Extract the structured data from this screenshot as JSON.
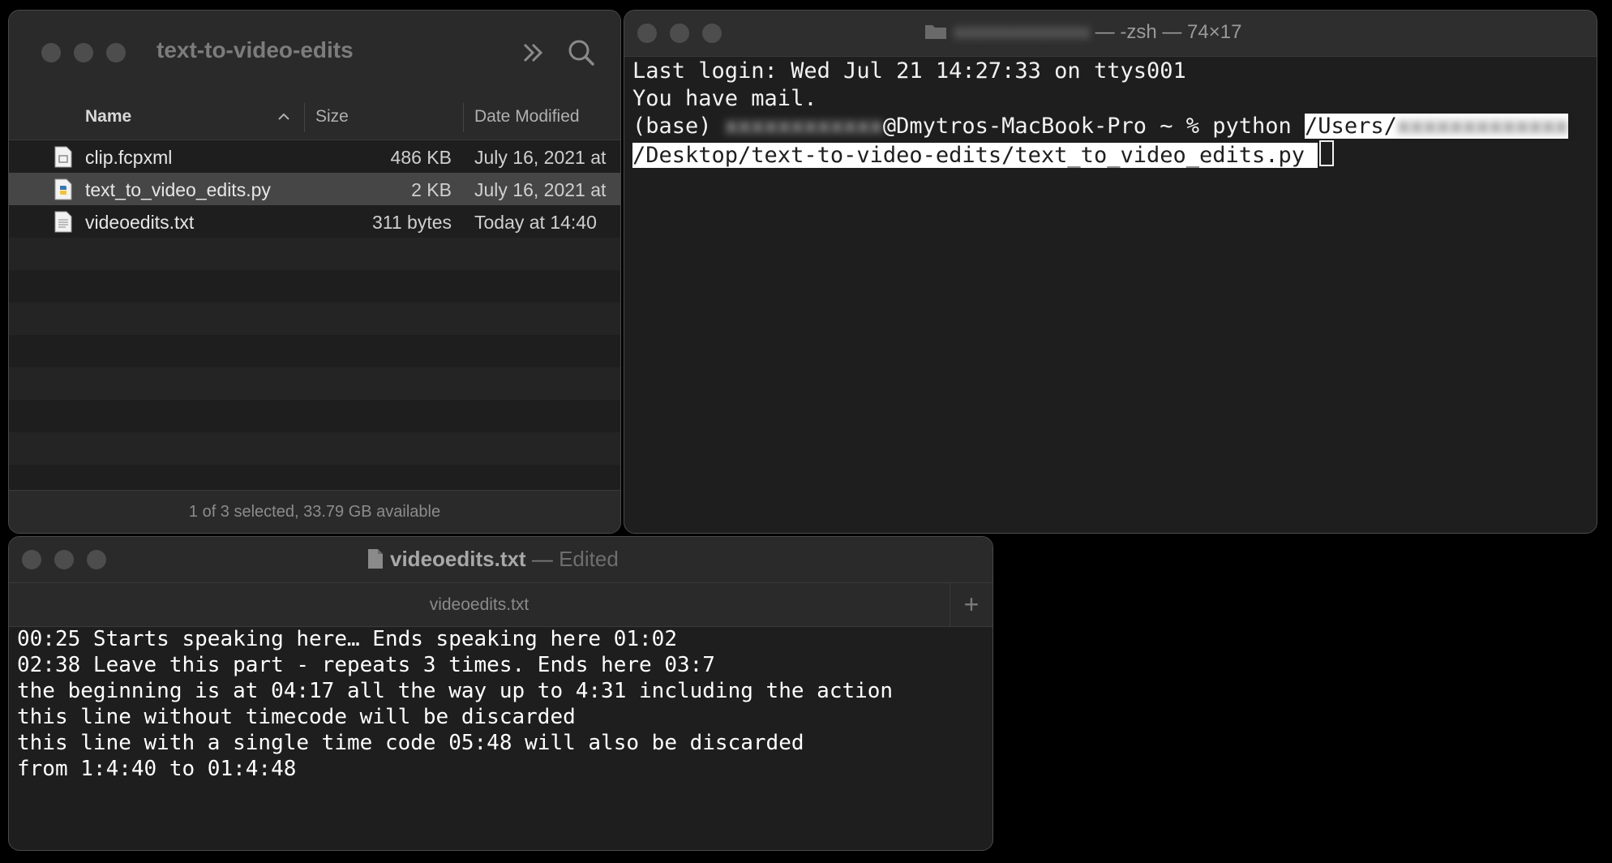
{
  "finder": {
    "title": "text-to-video-edits",
    "columns": {
      "name": "Name",
      "size": "Size",
      "date": "Date Modified"
    },
    "files": [
      {
        "name": "clip.fcpxml",
        "size": "486 KB",
        "date": "July 16, 2021 at",
        "icon": "fcpxml-file-icon",
        "selected": false
      },
      {
        "name": "text_to_video_edits.py",
        "size": "2 KB",
        "date": "July 16, 2021 at",
        "icon": "python-file-icon",
        "selected": true
      },
      {
        "name": "videoedits.txt",
        "size": "311 bytes",
        "date": "Today at 14:40",
        "icon": "text-file-icon",
        "selected": false
      }
    ],
    "status": "1 of 3 selected, 33.79 GB available"
  },
  "terminal": {
    "title_suffix": "— -zsh — 74×17",
    "lines": {
      "l1": "Last login: Wed Jul 21 14:27:33 on ttys001",
      "l2": "You have mail.",
      "l3_prefix": "(base) ",
      "l3_host": "@Dmytros-MacBook-Pro ~ % python ",
      "l3_path": "/Users/",
      "l4_path": "/Desktop/text-to-video-edits/text_to_video_edits.py "
    }
  },
  "textedit": {
    "doc_name": "videoedits.txt",
    "separator": "—",
    "state": "Edited",
    "tab_label": "videoedits.txt",
    "plus_label": "+",
    "lines": [
      "00:25 Starts speaking here… Ends speaking here 01:02",
      "02:38 Leave this part - repeats 3 times. Ends here 03:7",
      "the beginning is at 04:17 all the way up to 4:31 including the action",
      "this line without timecode will be discarded",
      "this line with a single time code 05:48 will also be discarded",
      "from 1:4:40 to 01:4:48"
    ]
  }
}
